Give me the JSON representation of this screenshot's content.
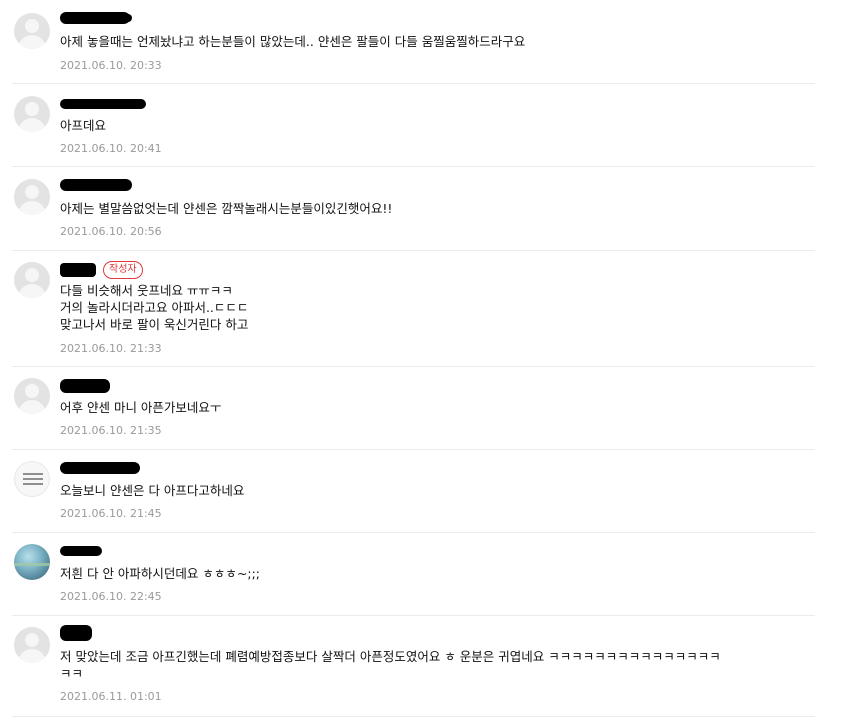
{
  "comments": [
    {
      "text": "아제 놓을때는 언제놨냐고 하는분들이 많았는데.. 얀센은 팔들이 다들 움찔움찔하드라구요",
      "date": "2021.06.10. 20:33"
    },
    {
      "text": "아프데요",
      "date": "2021.06.10. 20:41"
    },
    {
      "text": "아제는 별말씀없엇는데 얀센은 깜짝놀래시는분들이있긴햇어요!!",
      "date": "2021.06.10. 20:56"
    },
    {
      "badge": "작성자",
      "text": "다들 비슷해서 웃프네요 ㅠㅠㅋㅋ\n거의 놀라시더라고요 아파서..ㄷㄷㄷ\n맞고나서 바로 팔이 욱신거린다 하고",
      "date": "2021.06.10. 21:33"
    },
    {
      "text": "어후 얀센 마니 아픈가보네요ㅜ",
      "date": "2021.06.10. 21:35"
    },
    {
      "text": "오늘보니 얀센은 다 아프다고하네요",
      "date": "2021.06.10. 21:45"
    },
    {
      "text": "저흰 다 안 아파하시던데요 ㅎㅎㅎ~;;;",
      "date": "2021.06.10. 22:45"
    },
    {
      "text": "저 맞았는데 조금 아프긴했는데 폐렴예방접종보다 살짝더 아픈정도였어요 ㅎ 운분은 귀엽네요 ㅋㅋㅋㅋㅋㅋㅋㅋㅋㅋㅋㅋㅋㅋㅋ\nㅋㅋ",
      "date": "2021.06.11. 01:01"
    }
  ]
}
